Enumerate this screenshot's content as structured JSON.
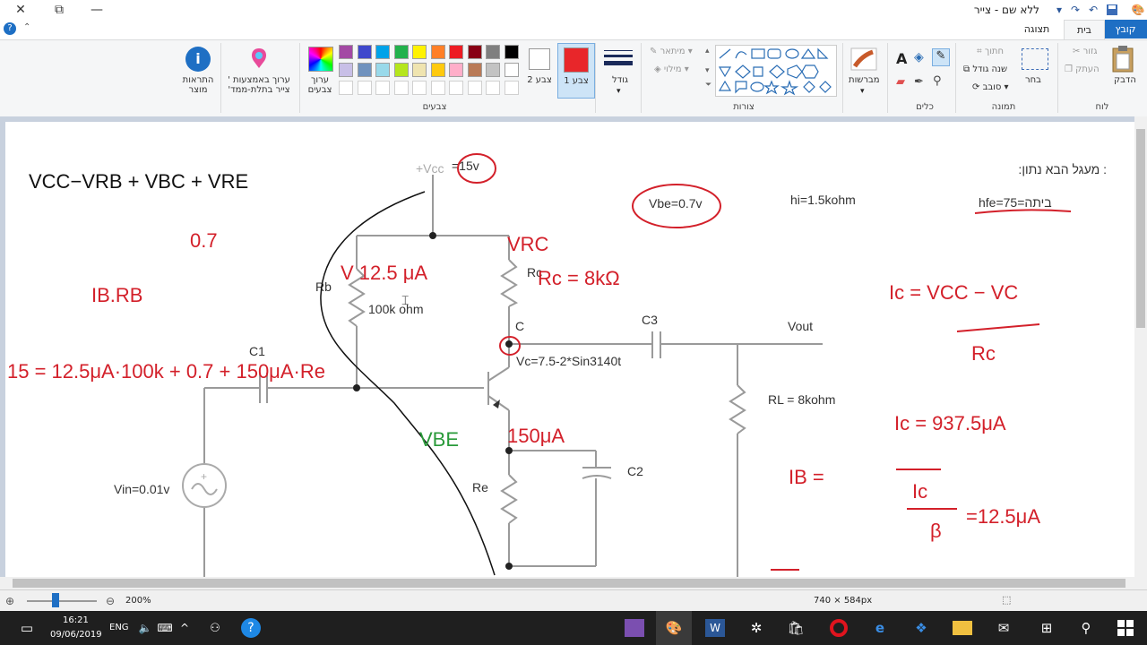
{
  "window": {
    "title": "ללא שם - צייר",
    "close": "✕",
    "restore": "⧉",
    "minimize": "—"
  },
  "tabs": {
    "file": "קובץ",
    "home": "בית",
    "view": "תצוגה"
  },
  "ribbon": {
    "clipboard": {
      "group": "לוח",
      "paste": "הדבק",
      "cut": "גזור",
      "copy": "העתק"
    },
    "image": {
      "group": "תמונה",
      "select": "בחר",
      "crop": "חתוך",
      "resize": "שנה גודל",
      "rotate": "סובב"
    },
    "tools": {
      "group": "כלים"
    },
    "brushes": {
      "label": "מברשות"
    },
    "shapes": {
      "group": "צורות",
      "outline": "מיתאר",
      "fill": "מילוי"
    },
    "size": {
      "label": "גודל"
    },
    "colors": {
      "group": "צבעים",
      "color1": "צבע 1",
      "color2": "צבע 2",
      "edit_colors": "ערוך צבעים",
      "edit_3d": "ערוך באמצעות ' צייר בתלת-ממד'",
      "product_alert": "התראות מוצר",
      "color1_value": "#e8262a",
      "color2_value": "#ffffff",
      "palette_row1": [
        "#000000",
        "#7f7f7f",
        "#880015",
        "#ed1c24",
        "#ff7f27",
        "#fff200",
        "#22b14c",
        "#00a2e8",
        "#3f48cc",
        "#a349a4"
      ],
      "palette_row2": [
        "#ffffff",
        "#c3c3c3",
        "#b97a57",
        "#ffaec9",
        "#ffc90e",
        "#efe4b0",
        "#b5e61d",
        "#99d9ea",
        "#7092be",
        "#c8bfe7"
      ]
    }
  },
  "canvas_text": {
    "given": ":מעגל הבא נתון :",
    "vbe": "Vbe=0.7v",
    "hi": "hi=1.5kohm",
    "hfe": "hfe=ביתה=75",
    "vcc": "+Vcc",
    "vcc_val": "=15v",
    "rb": "Rb",
    "rb_val": "100k ohm",
    "rc": "Rc",
    "c_node": "C",
    "c1": "C1",
    "c3": "C3",
    "vout": "Vout",
    "vc_eq": "Vc=7.5-2*Sin3140t",
    "rl": "RL = 8kohm",
    "c2": "C2",
    "re": "Re",
    "vin": "Vin=0.01v",
    "hw_top": "VCC−VRB + VBC + VRE",
    "hw_07": "0.7",
    "hw_irb": "IB.RB",
    "hw_12": "V 12.5 μA",
    "hw_rc": "Rc = 8kΩ",
    "hw_vrc": "VRC",
    "hw_15": "15 = 12.5μA·100k + 0.7 + 150μA·Re",
    "hw_vbe": "VBE",
    "hw_ie": "150μA",
    "hw_ic_eq": "Ic = VCC − VC",
    "hw_ic_den": "Rc",
    "hw_ic_val": "Ic = 937.5μA",
    "hw_ib": "IB =",
    "hw_ib_num": "Ic",
    "hw_ib_den": "β",
    "hw_ib_val": "=12.5μA"
  },
  "status": {
    "zoom": "200%",
    "dimensions": "740 × 584px"
  },
  "taskbar": {
    "time": "16:21",
    "date": "09/06/2019",
    "lang": "ENG"
  }
}
